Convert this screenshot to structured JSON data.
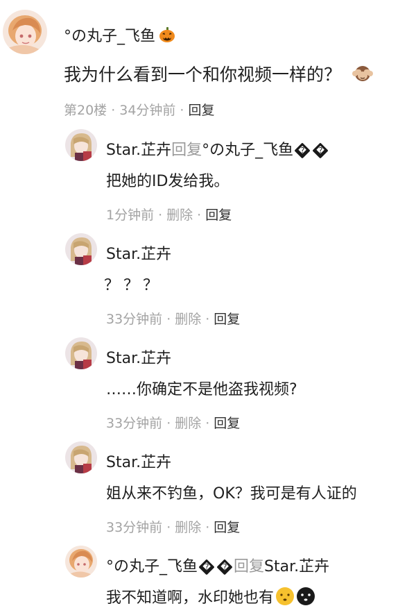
{
  "main_comment": {
    "author": "°の丸子_飞鱼",
    "author_icon": "pumpkin-icon",
    "text": "我为什么看到一个和你视频一样的？",
    "text_icon": "see-no-evil-monkey-icon",
    "floor": "第20楼",
    "time": "34分钟前",
    "reply_label": "回复"
  },
  "replies": [
    {
      "author": "Star.芷卉",
      "reply_word": "回复",
      "reply_to": "°の丸子_飞鱼",
      "garbled": "�",
      "text": "把她的ID发给我。",
      "time": "1分钟前",
      "delete_label": "删除",
      "reply_label": "回复"
    },
    {
      "author": "Star.芷卉",
      "text": "？？？",
      "time": "33分钟前",
      "delete_label": "删除",
      "reply_label": "回复"
    },
    {
      "author": "Star.芷卉",
      "text": "……你确定不是他盗我视频?",
      "time": "33分钟前",
      "delete_label": "删除",
      "reply_label": "回复"
    },
    {
      "author": "Star.芷卉",
      "text": "姐从来不钓鱼，OK？我可是有人证的",
      "time": "33分钟前",
      "delete_label": "删除",
      "reply_label": "回复"
    },
    {
      "author": "°の丸子_飞鱼",
      "garbled": "�",
      "reply_word": "回复",
      "reply_to": "Star.芷卉",
      "text": "我不知道啊，水印她也有",
      "icons": [
        "yellow-face-icon",
        "black-face-icon"
      ]
    }
  ],
  "colors": {
    "text": "#1f1f1f",
    "meta": "#a3a3a3",
    "reply_word": "#9a9a9a"
  }
}
